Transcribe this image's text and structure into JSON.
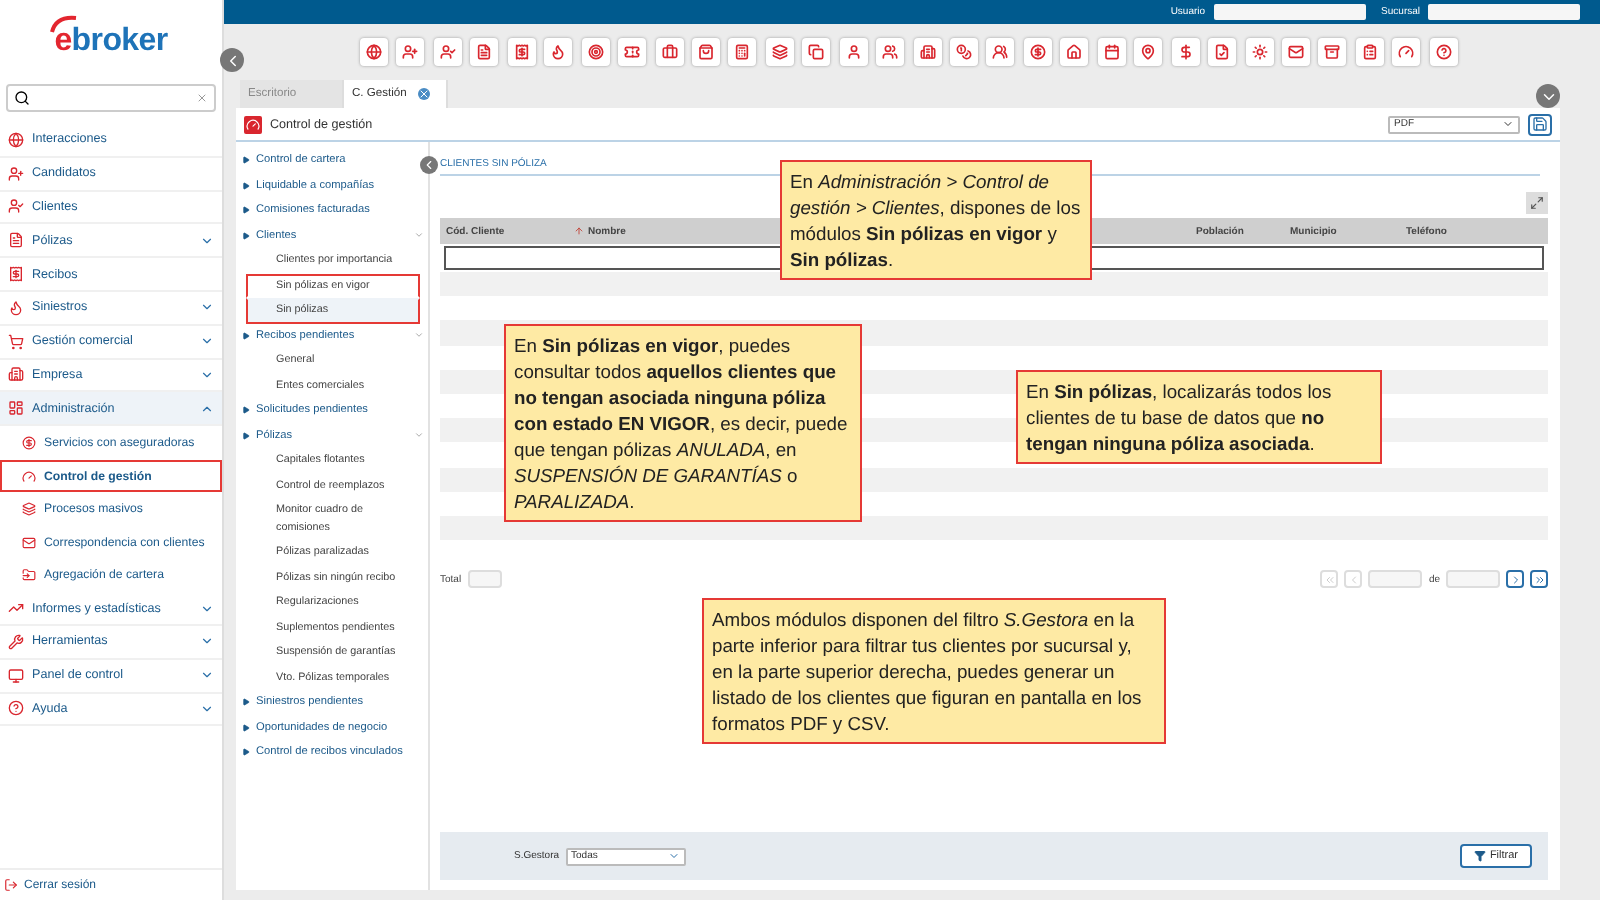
{
  "sidebar": {
    "logo": "ebroker",
    "items": [
      {
        "label": "Interacciones",
        "kind": "link"
      },
      {
        "label": "Candidatos",
        "kind": "link"
      },
      {
        "label": "Clientes",
        "kind": "link"
      },
      {
        "label": "Pólizas",
        "kind": "group",
        "expanded": false
      },
      {
        "label": "Recibos",
        "kind": "link"
      },
      {
        "label": "Siniestros",
        "kind": "group",
        "expanded": false
      },
      {
        "label": "Gestión comercial",
        "kind": "group",
        "expanded": false
      },
      {
        "label": "Empresa",
        "kind": "group",
        "expanded": false
      },
      {
        "label": "Administración",
        "kind": "group",
        "expanded": true,
        "children": [
          {
            "label": "Servicios con aseguradoras",
            "selected": false,
            "highlighted": false
          },
          {
            "label": "Control de gestión",
            "selected": true,
            "highlighted": true
          },
          {
            "label": "Procesos masivos",
            "selected": false,
            "highlighted": false
          },
          {
            "label": "Correspondencia con clientes",
            "selected": false,
            "highlighted": false
          },
          {
            "label": "Agregación de cartera",
            "selected": false,
            "highlighted": false
          }
        ]
      },
      {
        "label": "Informes y estadísticas",
        "kind": "group",
        "expanded": false
      },
      {
        "label": "Herramientas",
        "kind": "group",
        "expanded": false
      },
      {
        "label": "Panel de control",
        "kind": "group",
        "expanded": false
      },
      {
        "label": "Ayuda",
        "kind": "group",
        "expanded": false
      }
    ],
    "logout": "Cerrar sesión"
  },
  "top_bar": {
    "user_label": "Usuario",
    "branch_label": "Sucursal"
  },
  "tabs": [
    {
      "label": "Escritorio",
      "selected": false,
      "closable": false
    },
    {
      "label": "C. Gestión",
      "selected": true,
      "closable": true
    }
  ],
  "panel": {
    "title": "Control de gestión",
    "export_format": "PDF",
    "tree": [
      {
        "label": "Control de cartera",
        "expanded": false
      },
      {
        "label": "Liquidable a compañías",
        "expanded": false
      },
      {
        "label": "Comisiones facturadas",
        "expanded": false
      },
      {
        "label": "Clientes",
        "expanded": true,
        "children": [
          {
            "label": "Clientes por importancia",
            "selected": false,
            "highlighted": false
          },
          {
            "label": "Sin pólizas en vigor",
            "selected": false,
            "highlighted": true
          },
          {
            "label": "Sin pólizas",
            "selected": true,
            "highlighted": true
          }
        ]
      },
      {
        "label": "Recibos pendientes",
        "expanded": true,
        "children": [
          {
            "label": "General",
            "selected": false,
            "highlighted": false
          },
          {
            "label": "Entes comerciales",
            "selected": false,
            "highlighted": false
          }
        ]
      },
      {
        "label": "Solicitudes pendientes",
        "expanded": false
      },
      {
        "label": "Pólizas",
        "expanded": true,
        "children": [
          {
            "label": "Capitales flotantes",
            "selected": false,
            "highlighted": false
          },
          {
            "label": "Control de reemplazos",
            "selected": false,
            "highlighted": false
          },
          {
            "label": "Monitor cuadro de comisiones",
            "selected": false,
            "highlighted": false
          },
          {
            "label": "Pólizas paralizadas",
            "selected": false,
            "highlighted": false
          },
          {
            "label": "Pólizas sin ningún recibo",
            "selected": false,
            "highlighted": false
          },
          {
            "label": "Regularizaciones",
            "selected": false,
            "highlighted": false
          },
          {
            "label": "Suplementos pendientes",
            "selected": false,
            "highlighted": false
          },
          {
            "label": "Suspensión de garantías",
            "selected": false,
            "highlighted": false
          },
          {
            "label": "Vto. Pólizas temporales",
            "selected": false,
            "highlighted": false
          }
        ]
      },
      {
        "label": "Siniestros pendientes",
        "expanded": false
      },
      {
        "label": "Oportunidades de negocio",
        "expanded": false
      },
      {
        "label": "Control de recibos vinculados",
        "expanded": false
      }
    ],
    "content": {
      "title": "CLIENTES SIN PÓLIZA",
      "columns": [
        {
          "label": "Cód. Cliente",
          "sorted": false
        },
        {
          "label": "Nombre",
          "sorted": true
        },
        {
          "label": "Población",
          "sorted": false
        },
        {
          "label": "Municipio",
          "sorted": false
        },
        {
          "label": "Teléfono",
          "sorted": false
        }
      ],
      "total_label": "Total",
      "pager": {
        "of_label": "de",
        "at_start": true,
        "at_end": false
      },
      "filter": {
        "label": "S.Gestora",
        "value": "Todas",
        "button": "Filtrar"
      }
    }
  },
  "callouts": [
    {
      "text": "En *Administración > Control de gestión > Clientes*, dispones de los módulos **Sin pólizas en vigor** y **Sin pólizas**."
    },
    {
      "text": "En **Sin pólizas en vigor**, puedes consultar todos **aquellos clientes que no tengan asociada ninguna póliza con estado EN VIGOR**, es decir, puede que tengan pólizas *ANULADA*, en *SUSPENSIÓN DE GARANTÍAS* o *PARALIZADA*."
    },
    {
      "text": "En **Sin pólizas**, localizarás todos los clientes de tu base de datos que **no tengan ninguna póliza asociada**."
    },
    {
      "text": "Ambos módulos disponen del filtro *S.Gestora* en la parte inferior para filtrar tus clientes por sucursal y, en la parte superior derecha, puedes generar un listado de los clientes que figuran en pantalla en los formatos PDF y CSV."
    }
  ]
}
